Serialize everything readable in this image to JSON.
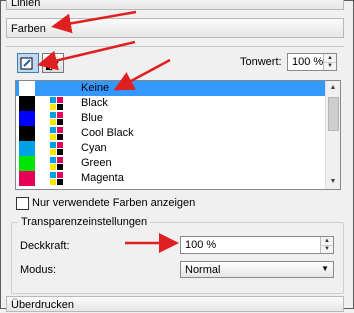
{
  "sections": {
    "top": "Linien",
    "farben": "Farben",
    "bottom": "Überdrucken"
  },
  "toolbar": {
    "fill_icon": "fill-bucket-icon",
    "outline_icon": "pen-outline-icon"
  },
  "tonwert": {
    "label": "Tonwert:",
    "value": "100 %"
  },
  "colors": [
    {
      "name": "Keine",
      "swatch": "#ffffff",
      "selected": true
    },
    {
      "name": "Black",
      "swatch": "#000000"
    },
    {
      "name": "Blue",
      "swatch": "#0000ff"
    },
    {
      "name": "Cool Black",
      "swatch": "#000000"
    },
    {
      "name": "Cyan",
      "swatch": "#00a0e6"
    },
    {
      "name": "Green",
      "swatch": "#00e600"
    },
    {
      "name": "Magenta",
      "swatch": "#e6005a"
    }
  ],
  "only_used": {
    "label": "Nur verwendete Farben anzeigen",
    "checked": false
  },
  "transparency": {
    "title": "Transparenzeinstellungen",
    "opacity_label": "Deckkraft:",
    "opacity_value": "100 %",
    "mode_label": "Modus:",
    "mode_value": "Normal"
  },
  "accent_colors": {
    "annotation_arrow": "#e02020",
    "selection": "#3399ff"
  }
}
